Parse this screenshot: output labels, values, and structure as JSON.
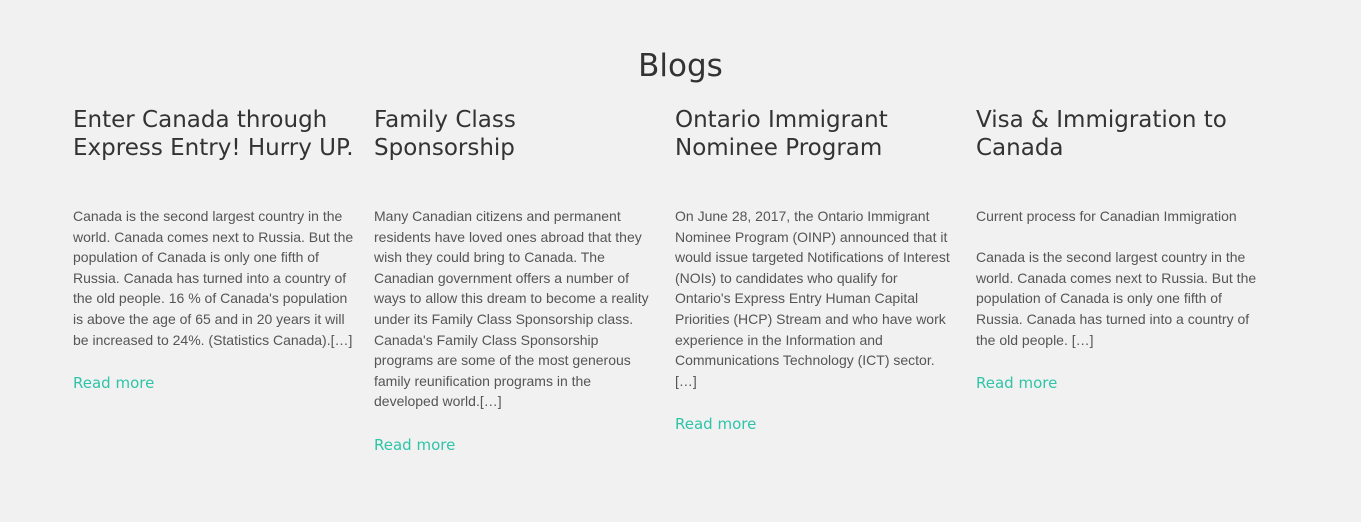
{
  "section": {
    "title": "Blogs"
  },
  "posts": [
    {
      "title": "Enter Canada through Express Entry! Hurry UP.",
      "paragraphs": [
        "Canada is the second largest country in the world. Canada comes next to Russia. But the population of Canada is only one fifth of Russia. Canada has turned into a country of the old people. 16 % of Canada's population is above the age of 65 and in 20 years it will be increased to 24%. (Statistics Canada).[…]"
      ],
      "read_more": "Read more"
    },
    {
      "title": "Family Class Sponsorship",
      "paragraphs": [
        "Many Canadian citizens and permanent residents have loved ones abroad that they wish they could bring to Canada. The Canadian government offers a number of ways to allow this dream to become a reality under its Family Class Sponsorship class. Canada's Family Class Sponsorship programs are some of the most generous family reunification programs in the developed world.[…]"
      ],
      "read_more": "Read more"
    },
    {
      "title": "Ontario Immigrant Nominee Program",
      "paragraphs": [
        "On June 28, 2017, the Ontario Immigrant Nominee Program (OINP) announced that it would issue targeted Notifications of Interest (NOIs) to candidates who qualify for Ontario's Express Entry Human Capital Priorities (HCP) Stream and who have work experience in the Information and Communications Technology (ICT) sector. […]"
      ],
      "read_more": "Read more"
    },
    {
      "title": "Visa & Immigration to Canada",
      "paragraphs": [
        "Current process for Canadian Immigration",
        "Canada is the second largest country in the world. Canada comes next to Russia. But the population of Canada is only one fifth of Russia. Canada has turned into a country of the old people. […]"
      ],
      "read_more": "Read more"
    }
  ],
  "colors": {
    "background": "#f1f1f1",
    "heading": "#333333",
    "body_text": "#555555",
    "link_accent": "#2fc4a8"
  }
}
